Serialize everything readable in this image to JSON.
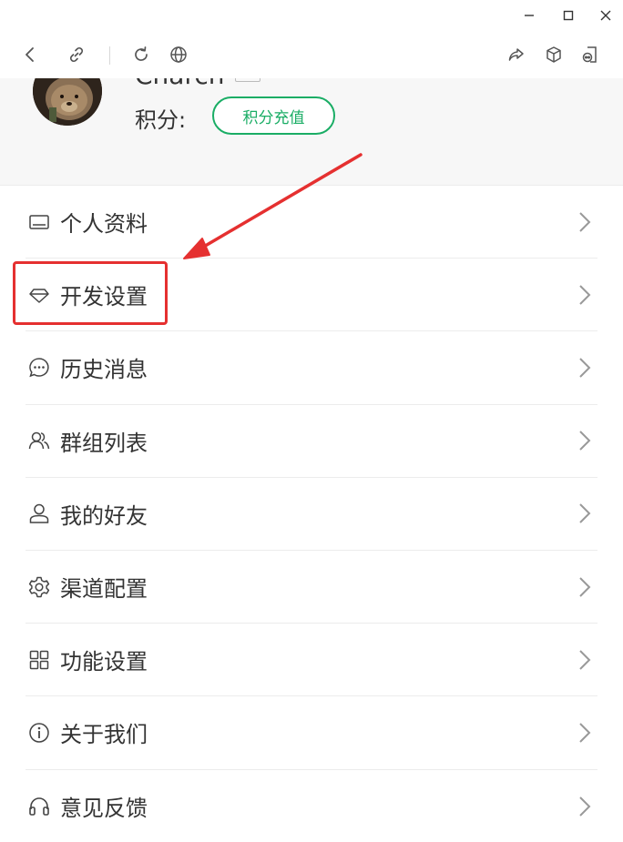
{
  "window": {
    "minimize_icon": "minimize-icon",
    "maximize_icon": "maximize-icon",
    "close_icon": "close-icon"
  },
  "toolbar": {
    "icons": [
      "back-icon",
      "link-icon",
      "refresh-icon",
      "globe-icon",
      "share-icon",
      "cube-icon",
      "device-icon"
    ]
  },
  "profile": {
    "username": "Charch",
    "points_label": "积分:",
    "recharge_label": "积分充值"
  },
  "menu": {
    "items": [
      {
        "label": "个人资料",
        "icon": "id-card-icon"
      },
      {
        "label": "开发设置",
        "icon": "diamond-icon"
      },
      {
        "label": "历史消息",
        "icon": "chat-bubble-icon"
      },
      {
        "label": "群组列表",
        "icon": "group-icon"
      },
      {
        "label": "我的好友",
        "icon": "user-icon"
      },
      {
        "label": "渠道配置",
        "icon": "gear-icon"
      },
      {
        "label": "功能设置",
        "icon": "grid-icon"
      },
      {
        "label": "关于我们",
        "icon": "info-icon"
      },
      {
        "label": "意见反馈",
        "icon": "headset-icon"
      }
    ]
  },
  "colors": {
    "accent": "#1aad65",
    "annotation": "#e53030",
    "header_bg": "#f7f7f7"
  }
}
